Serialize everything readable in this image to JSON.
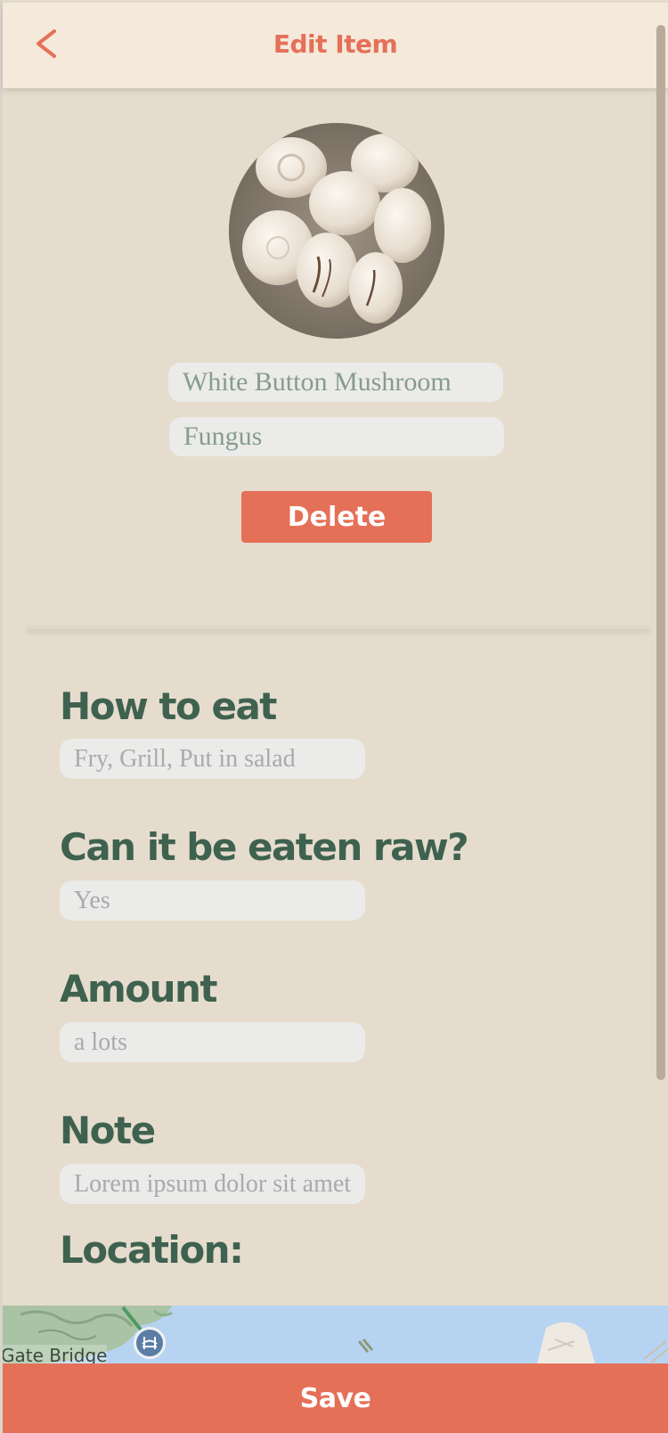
{
  "header": {
    "title": "Edit Item",
    "back_icon": "chevron-left-icon"
  },
  "colors": {
    "accent": "#e57058",
    "label": "#3f6250",
    "background": "#e6dccd",
    "header": "#f4e9da",
    "field": "#ebebe9"
  },
  "item": {
    "image": "mushroom-photo",
    "name": "White Button Mushroom",
    "category": "Fungus",
    "delete_label": "Delete"
  },
  "details": [
    {
      "label": "How to eat",
      "value": "Fry, Grill, Put in salad"
    },
    {
      "label": "Can it be eaten raw?",
      "value": "Yes"
    },
    {
      "label": "Amount",
      "value": "a lots"
    },
    {
      "label": "Note",
      "value": "Lorem ipsum dolor sit amet"
    }
  ],
  "location": {
    "label": "Location:",
    "map_label": "Gate Bridge",
    "map_icon": "bridge-icon"
  },
  "footer": {
    "save_label": "Save"
  }
}
